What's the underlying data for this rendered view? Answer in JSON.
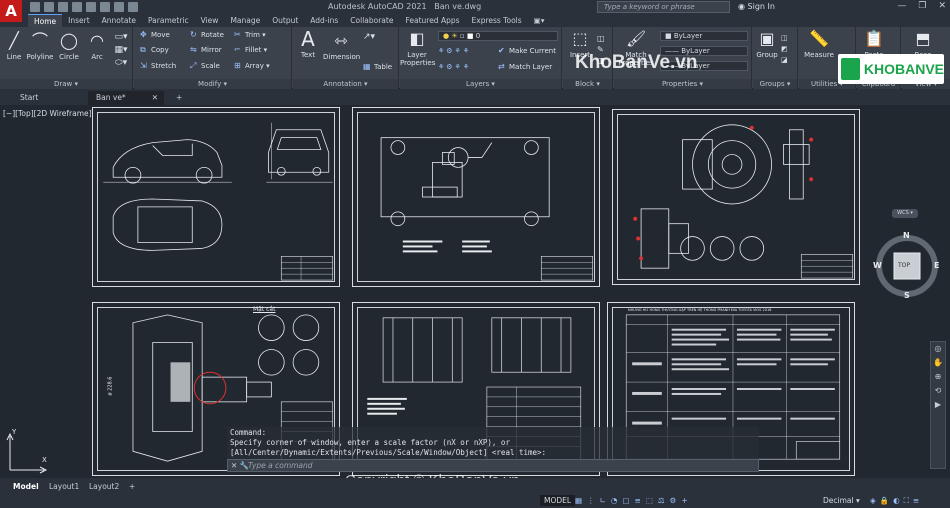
{
  "app": {
    "logo_letter": "A",
    "title": "Autodesk AutoCAD 2021",
    "filename": "Ban ve.dwg",
    "search_placeholder": "Type a keyword or phrase",
    "sign_in": "Sign In",
    "min": "—",
    "max": "❐",
    "close": "✕"
  },
  "ribbon_tabs": [
    "Home",
    "Insert",
    "Annotate",
    "Parametric",
    "View",
    "Manage",
    "Output",
    "Add-ins",
    "Collaborate",
    "Featured Apps",
    "Express Tools"
  ],
  "ribbon_tabs_extra": "▣▾",
  "ribbon": {
    "draw": {
      "label": "Draw ▾",
      "line": "Line",
      "polyline": "Polyline",
      "circle": "Circle",
      "arc": "Arc"
    },
    "modify": {
      "label": "Modify ▾",
      "move": "Move",
      "rotate": "Rotate",
      "trim": "Trim ▾",
      "copy": "Copy",
      "mirror": "Mirror",
      "fillet": "Fillet ▾",
      "stretch": "Stretch",
      "scale": "Scale",
      "array": "Array ▾"
    },
    "annotation": {
      "label": "Annotation ▾",
      "text": "Text",
      "dimension": "Dimension",
      "table": "Table"
    },
    "layers": {
      "label": "Layers ▾",
      "layer_properties": "Layer Properties",
      "current_layer": "0",
      "make_current": "Make Current",
      "match_layer": "Match Layer"
    },
    "block": {
      "label": "Block ▾",
      "insert": "Insert"
    },
    "properties": {
      "label": "Properties ▾",
      "match_properties": "Match Properties",
      "bylayer1": "ByLayer",
      "bylayer2": "ByLayer",
      "bylayer3": "ByLayer"
    },
    "groups": {
      "label": "Groups ▾",
      "group": "Group"
    },
    "utilities": {
      "label": "Utilities ▾",
      "measure": "Measure"
    },
    "clipboard": {
      "label": "Clipboard",
      "paste": "Paste"
    },
    "view": {
      "label": "View ▾",
      "base": "Base"
    }
  },
  "file_tabs": {
    "start": "Start",
    "current": "Ban ve*",
    "close": "✕",
    "add": "+"
  },
  "viewport_label": "[−][Top][2D Wireframe]",
  "viewcube": {
    "n": "N",
    "s": "S",
    "e": "E",
    "w": "W",
    "top": "TOP",
    "wcs": "WCS ▾"
  },
  "ucs": {
    "x": "X",
    "y": "Y"
  },
  "command": {
    "history": [
      "Command:",
      "Specify corner of window, enter a scale factor (nX or nXP), or",
      "[All/Center/Dynamic/Extents/Previous/Scale/Window/Object] <real time>:"
    ],
    "placeholder": "Type a command"
  },
  "layout_tabs": [
    "Model",
    "Layout1",
    "Layout2"
  ],
  "layout_add": "+",
  "status": {
    "model": "MODEL",
    "units": "Decimal"
  },
  "watermark": {
    "copyright": "Copyright © KhoBanVe.vn",
    "site": "KhoBanVe.vn",
    "brand": "KHOBANVE"
  },
  "sheet_titles": {
    "sheet4_label": "Mặt cắt",
    "sheet4_dim": "ø 228.6",
    "sheet6_header": "NHỮNG HƯ HỎNG THƯỜNG GẶP TRÊN HỆ THỐNG PHANH ĐĨA TOYOTA VIOS 2016"
  },
  "colors": {
    "accent": "#5fa1ff",
    "logo_red": "#c41a1a",
    "drawing_bg": "#212830",
    "linework": "#e8ecef",
    "callout_red": "#e03030",
    "brand_green": "#1aa44b"
  }
}
